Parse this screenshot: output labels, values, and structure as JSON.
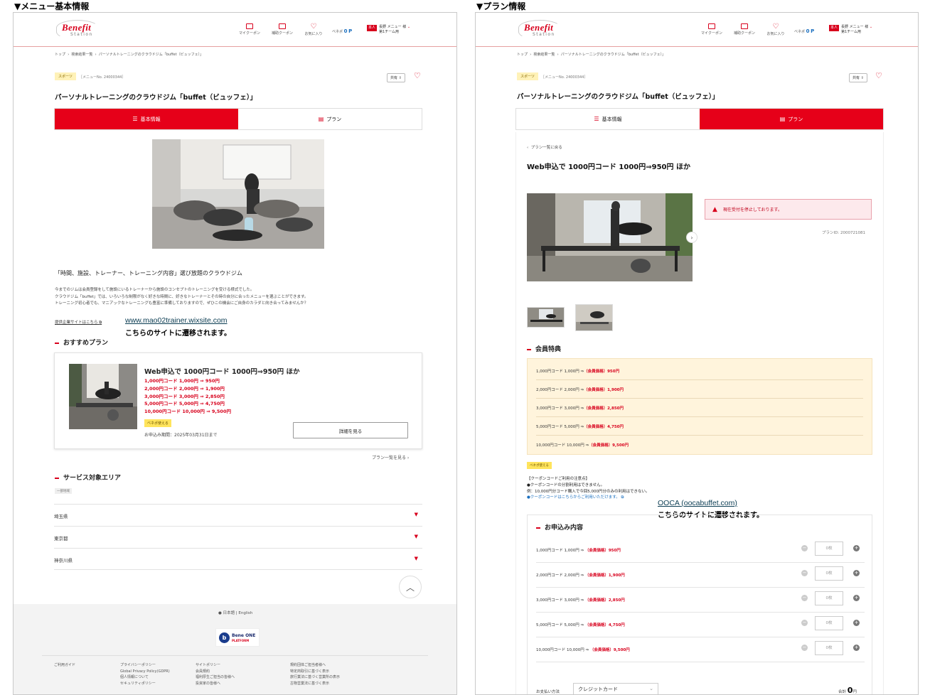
{
  "section_titles": {
    "left": "▼メニュー基本情報",
    "right": "▼プラン情報"
  },
  "header": {
    "logo_main": "Benefit",
    "logo_sub": "Station",
    "nav": [
      {
        "label": "マイクーポン",
        "icon": "coupon-icon"
      },
      {
        "label": "補助クーポン",
        "icon": "ticket-icon"
      },
      {
        "label": "お気に入り",
        "icon": "heart-icon"
      }
    ],
    "bene_point_label": "ベネポ",
    "bene_point_value": "0",
    "bene_point_unit": "P",
    "user_tag": "本人",
    "user_name_1": "長野 メニュー",
    "user_name_2": "第1チーム用",
    "user_suffix": "様"
  },
  "breadcrumb": [
    "トップ",
    "検索結果一覧",
    "パーソナルトレーニングのクラウドジム「buffet（ビュッフェ）」"
  ],
  "menu": {
    "category": "スポーツ",
    "menu_no": "［メニューNo. 24000344］",
    "share_label": "共有",
    "title": "パーソナルトレーニングのクラウドジム「buffet（ビュッフェ）」",
    "tab_info": "基本情報",
    "tab_plan": "プラン"
  },
  "left": {
    "headline": "「時間、施設、トレーナー、トレーニング内容」選び放題のクラウドジム",
    "desc_lines": [
      "今までのジムは会員登録をして施設にいるトレーナーから施設のコンセプトのトレーニングを受ける様式でした。",
      "クラウドジム「buffet」では、いろいろな制限がなく好きな時間に、好きなトレーナーとその時の自分に合ったメニューを選ぶことができます。",
      "トレーニング初心者でも、マニアックなトレーニングも豊富に準備しておりますので、ぜひこの機会にご自身のカラダと向き合ってみませんか？"
    ],
    "company_link": "提供企業サイトはこちら",
    "url": "www.mao02trainer.wixsite.com",
    "url_note": "こちらのサイトに遷移されます。",
    "rec_heading": "おすすめプラン",
    "rec_title": "Web申込で 1000円コード 1000円⇒950円 ほか",
    "rec_lines": [
      "1,000円コード 1,000円 ⇒ 950円",
      "2,000円コード 2,000円 ⇒ 1,900円",
      "3,000円コード 3,000円 ⇒ 2,850円",
      "5,000円コード 5,000円 ⇒ 4,750円",
      "10,000円コード 10,000円 ⇒ 9,500円"
    ],
    "bene_badge": "ベネポ使える",
    "apply_period": "お申込み期間：2025年03月31日まで",
    "detail_button": "詳細を見る",
    "plan_list_link": "プラン一覧を見る",
    "area_heading": "サービス対象エリア",
    "area_tag": "一部地域",
    "areas": [
      "埼玉県",
      "東京都",
      "神奈川県"
    ],
    "footer_lang": "日本語 | English",
    "footer_logo_main": "Bene ONE",
    "footer_logo_sub": "PLATFORM",
    "footer_cols": [
      [
        "ご利用ガイド"
      ],
      [
        "プライバシーポリシー",
        "Global Privacy Policy(GDPR)",
        "個人情報について",
        "セキュリティポリシー"
      ],
      [
        "サイトポリシー",
        "会員規約",
        "福利厚生ご担当の皆様へ",
        "投資家の皆様へ"
      ],
      [
        "規約団体ご担当者様へ",
        "特定商取引に基づく表示",
        "旅行業法に基づく営業所の表示",
        "古物営業法に基づく表示"
      ]
    ]
  },
  "right": {
    "back_link": "プラン一覧に戻る",
    "plan_title": "Web申込で 1000円コード 1000円⇒950円 ほか",
    "alert": "現在受付を停止しております。",
    "plan_id": "プランID: 2000721081",
    "benefit_heading": "会員特典",
    "benefits": [
      {
        "pre": "1,000円コード 1,000円 ⇒ ",
        "price": "（会員価格）950円"
      },
      {
        "pre": "2,000円コード 2,000円 ⇒ ",
        "price": "（会員価格）1,900円"
      },
      {
        "pre": "3,000円コード 3,000円 ⇒ ",
        "price": "（会員価格）2,850円"
      },
      {
        "pre": "5,000円コード 5,000円 ⇒ ",
        "price": "（会員価格）4,750円"
      },
      {
        "pre": "10,000円コード 10,000円 ⇒ ",
        "price": "（会員価格）9,500円"
      }
    ],
    "bene_badge": "ベネポ使える",
    "notes": [
      "【クーポンコードご利用の注意点】",
      "●クーポンコードの分割利用はできません。",
      "例：10,000円分コード購入で今回5,000円分のみの利用はできない。"
    ],
    "notes_link": "●クーポンコードはこちらからご利用いただけます。",
    "url": "OOCA (oocabuffet.com)",
    "url_note": "こちらのサイトに遷移されます。",
    "apply_heading": "お申込み内容",
    "apply_rows": [
      {
        "pre": "1,000円コード 1,000円 ⇒ ",
        "price": "（会員価格）950円",
        "qty": "0枚"
      },
      {
        "pre": "2,000円コード 2,000円 ⇒ ",
        "price": "（会員価格）1,900円",
        "qty": "0枚"
      },
      {
        "pre": "3,000円コード 3,000円 ⇒ ",
        "price": "（会員価格）2,850円",
        "qty": "0枚"
      },
      {
        "pre": "5,000円コード 5,000円 ⇒ ",
        "price": "（会員価格）4,750円",
        "qty": "0枚"
      },
      {
        "pre": "10,000円コード 10,000円 ⇒ ",
        "price": "（会員価格）9,500円",
        "qty": "0枚"
      }
    ],
    "pay_label": "お支払い方法",
    "pay_value": "クレジットカード",
    "total_label": "合計",
    "total_value": "0",
    "total_unit": "円"
  }
}
